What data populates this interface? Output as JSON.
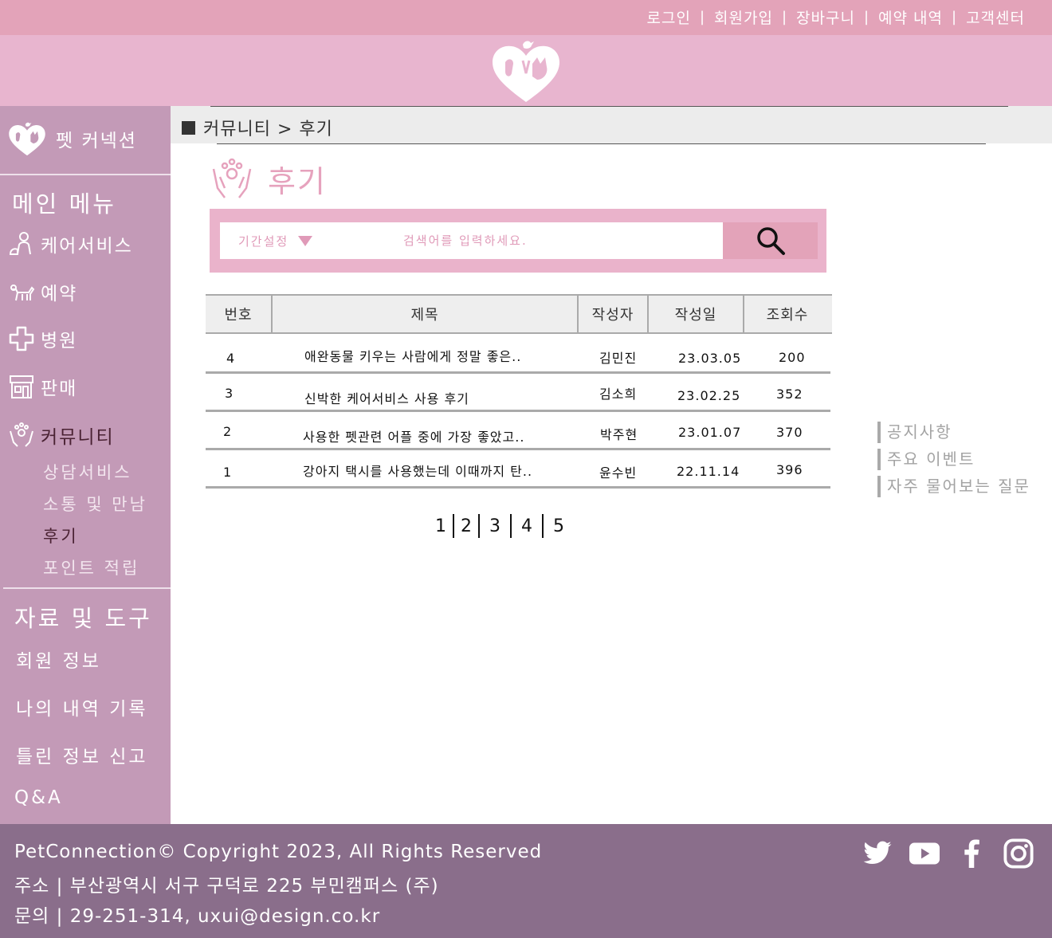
{
  "top_nav": {
    "login": "로그인",
    "signup": "회원가입",
    "cart": "장바구니",
    "reservations": "예약 내역",
    "support": "고객센터",
    "separator": "|"
  },
  "sidebar": {
    "brand": "펫 커넥션",
    "main_menu_heading": "메인 메뉴",
    "items": [
      {
        "label": "케어서비스",
        "icon": "care-service-icon"
      },
      {
        "label": "예약",
        "icon": "dog-icon"
      },
      {
        "label": "병원",
        "icon": "medical-cross-icon"
      },
      {
        "label": "판매",
        "icon": "store-icon"
      },
      {
        "label": "커뮤니티",
        "icon": "paw-hands-icon"
      }
    ],
    "community_sub": [
      "상담서비스",
      "소통 및 만남",
      "후기",
      "포인트 적립"
    ],
    "tools_heading": "자료 및 도구",
    "tools": [
      "회원 정보",
      "나의 내역 기록",
      "틀린 정보 신고",
      "Q&A"
    ]
  },
  "breadcrumb": {
    "text": "커뮤니티 > 후기"
  },
  "page_title": "후기",
  "search": {
    "period_label": "기간설정",
    "placeholder": "검색어를 입력하세요."
  },
  "table": {
    "headers": [
      "번호",
      "제목",
      "작성자",
      "작성일",
      "조회수"
    ],
    "rows": [
      {
        "no": "4",
        "title": "애완동물 키우는 사람에게 정말 좋은..",
        "author": "김민진",
        "date": "23.03.05",
        "views": "200"
      },
      {
        "no": "3",
        "title": "신박한 케어서비스 사용 후기",
        "author": "김소희",
        "date": "23.02.25",
        "views": "352"
      },
      {
        "no": "2",
        "title": "사용한 펫관련 어플 중에 가장 좋았고..",
        "author": "박주현",
        "date": "23.01.07",
        "views": "370"
      },
      {
        "no": "1",
        "title": "강아지 택시를 사용했는데 이때까지 탄..",
        "author": "윤수빈",
        "date": "22.11.14",
        "views": "396"
      }
    ]
  },
  "pagination": [
    "1",
    "2",
    "3",
    "4",
    "5"
  ],
  "quick_links": [
    "공지사항",
    "주요 이벤트",
    "자주 물어보는 질문"
  ],
  "footer": {
    "copyright": "PetConnection© Copyright 2023, All Rights Reserved",
    "address": "주소 | 부산광역시 서구 구덕로 225 부민캠퍼스 (주)",
    "contact": "문의 | 29-251-314, uxui@design.co.kr"
  },
  "social": [
    "twitter-icon",
    "youtube-icon",
    "facebook-icon",
    "instagram-icon"
  ],
  "colors": {
    "top_bar": "#e3a3b9",
    "header": "#e8b5cf",
    "sidebar": "#c39ab7",
    "footer": "#8a6e8b",
    "accent_pink": "#e6a2bd"
  }
}
